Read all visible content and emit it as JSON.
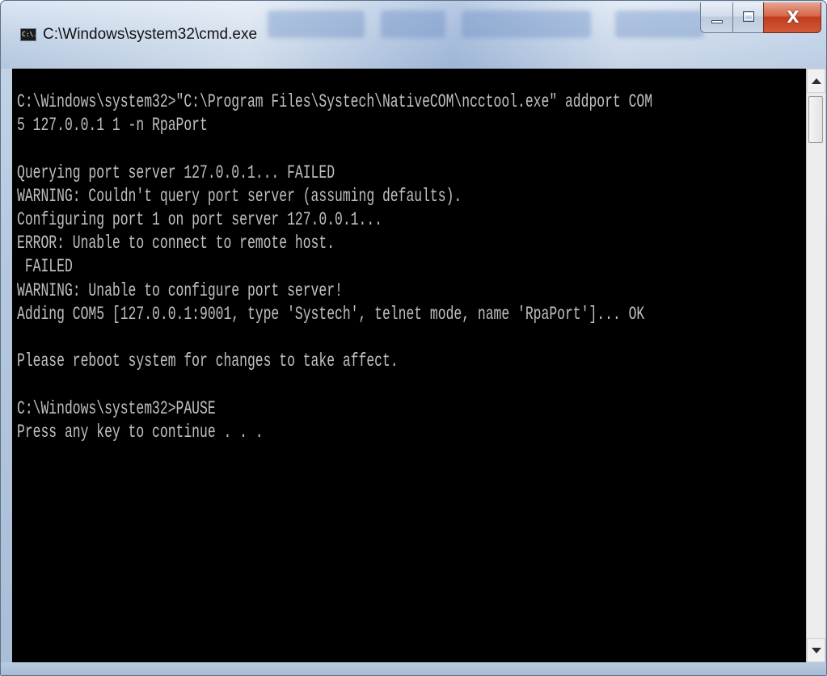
{
  "window": {
    "title": "C:\\Windows\\system32\\cmd.exe",
    "icon_name": "cmd-prompt-icon",
    "icon_label": "C:\\."
  },
  "caption_buttons": {
    "close_label": "X"
  },
  "console": {
    "background": "#000000",
    "foreground": "#c0c0c0",
    "lines": [
      "C:\\Windows\\system32>\"C:\\Program Files\\Systech\\NativeCOM\\ncctool.exe\" addport COM",
      "5 127.0.0.1 1 -n RpaPort",
      "",
      "Querying port server 127.0.0.1... FAILED",
      "WARNING: Couldn't query port server (assuming defaults).",
      "Configuring port 1 on port server 127.0.0.1...",
      "ERROR: Unable to connect to remote host.",
      " FAILED",
      "WARNING: Unable to configure port server!",
      "Adding COM5 [127.0.0.1:9001, type 'Systech', telnet mode, name 'RpaPort']... OK",
      "",
      "Please reboot system for changes to take affect.",
      "",
      "C:\\Windows\\system32>PAUSE",
      "Press any key to continue . . ."
    ]
  },
  "scrollbar": {
    "up_icon": "scroll-up-arrow-icon",
    "down_icon": "scroll-down-arrow-icon"
  }
}
